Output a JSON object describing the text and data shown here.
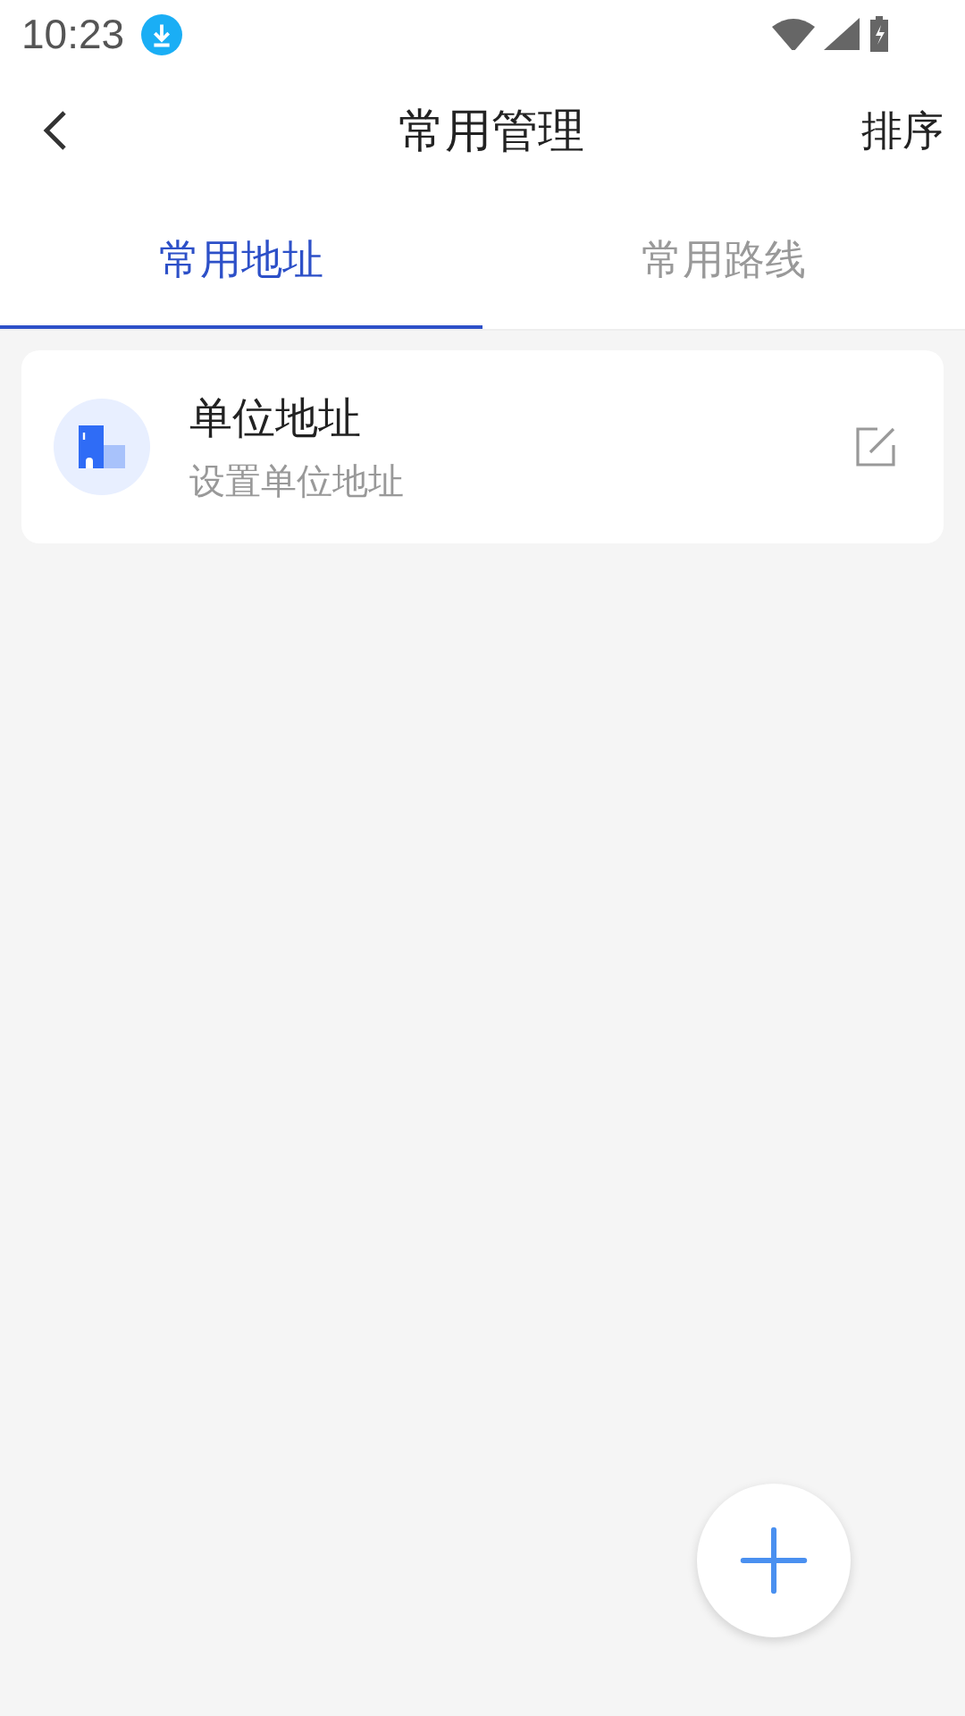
{
  "status_bar": {
    "time": "10:23"
  },
  "header": {
    "title": "常用管理",
    "action": "排序"
  },
  "tabs": [
    {
      "label": "常用地址",
      "selected": true
    },
    {
      "label": "常用路线",
      "selected": false
    }
  ],
  "addresses": [
    {
      "name": "单位地址",
      "hint": "设置单位地址"
    }
  ]
}
